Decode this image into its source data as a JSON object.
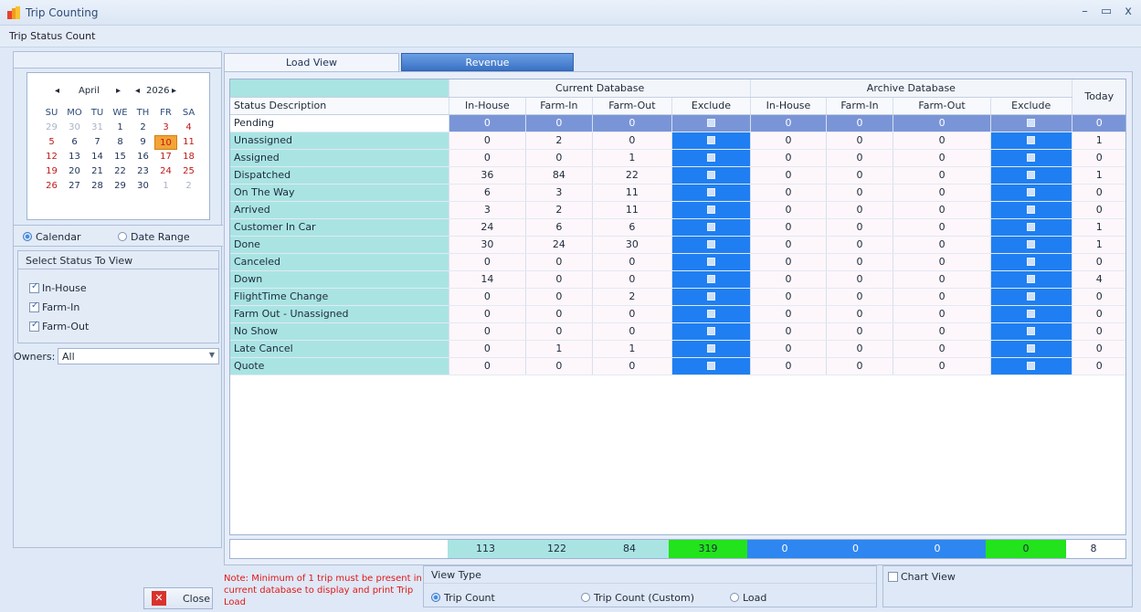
{
  "window": {
    "title": "Trip Counting",
    "controls": [
      "–",
      "▭",
      "x"
    ]
  },
  "subtitle": "Trip Status Count",
  "calendar": {
    "month": "April",
    "year": "2026",
    "prev": "◂",
    "next": "▸",
    "days_of_week": [
      "SU",
      "MO",
      "TU",
      "WE",
      "TH",
      "FR",
      "SA"
    ],
    "weeks": [
      [
        "29",
        "30",
        "31",
        "1",
        "2",
        "3",
        "4"
      ],
      [
        "5",
        "6",
        "7",
        "8",
        "9",
        "10",
        "11"
      ],
      [
        "12",
        "13",
        "14",
        "15",
        "16",
        "17",
        "18"
      ],
      [
        "19",
        "20",
        "21",
        "22",
        "23",
        "24",
        "25"
      ],
      [
        "26",
        "27",
        "28",
        "29",
        "30",
        "1",
        "2"
      ]
    ],
    "selected_day": "10"
  },
  "mode": {
    "calendar": "Calendar",
    "date_range": "Date Range",
    "selected": "calendar"
  },
  "status_filter": {
    "title": "Select Status To View",
    "items": [
      "In-House",
      "Farm-In",
      "Farm-Out"
    ]
  },
  "owners": {
    "label": "Owners:",
    "value": "All"
  },
  "close_label": "Close",
  "tabs": {
    "load_view": "Load View",
    "revenue": "Revenue"
  },
  "grid": {
    "groups": {
      "current": "Current Database",
      "archive": "Archive Database",
      "today": "Today"
    },
    "columns": [
      "Status Description",
      "In-House",
      "Farm-In",
      "Farm-Out",
      "Exclude",
      "In-House",
      "Farm-In",
      "Farm-Out",
      "Exclude"
    ],
    "rows": [
      {
        "desc": "Pending",
        "c": [
          "0",
          "0",
          "0"
        ],
        "a": [
          "0",
          "0",
          "0"
        ],
        "today": "0"
      },
      {
        "desc": "Unassigned",
        "c": [
          "0",
          "2",
          "0"
        ],
        "a": [
          "0",
          "0",
          "0"
        ],
        "today": "1"
      },
      {
        "desc": "Assigned",
        "c": [
          "0",
          "0",
          "1"
        ],
        "a": [
          "0",
          "0",
          "0"
        ],
        "today": "0"
      },
      {
        "desc": "Dispatched",
        "c": [
          "36",
          "84",
          "22"
        ],
        "a": [
          "0",
          "0",
          "0"
        ],
        "today": "1"
      },
      {
        "desc": "On The Way",
        "c": [
          "6",
          "3",
          "11"
        ],
        "a": [
          "0",
          "0",
          "0"
        ],
        "today": "0"
      },
      {
        "desc": "Arrived",
        "c": [
          "3",
          "2",
          "11"
        ],
        "a": [
          "0",
          "0",
          "0"
        ],
        "today": "0"
      },
      {
        "desc": "Customer In Car",
        "c": [
          "24",
          "6",
          "6"
        ],
        "a": [
          "0",
          "0",
          "0"
        ],
        "today": "1"
      },
      {
        "desc": "Done",
        "c": [
          "30",
          "24",
          "30"
        ],
        "a": [
          "0",
          "0",
          "0"
        ],
        "today": "1"
      },
      {
        "desc": "Canceled",
        "c": [
          "0",
          "0",
          "0"
        ],
        "a": [
          "0",
          "0",
          "0"
        ],
        "today": "0"
      },
      {
        "desc": "Down",
        "c": [
          "14",
          "0",
          "0"
        ],
        "a": [
          "0",
          "0",
          "0"
        ],
        "today": "4"
      },
      {
        "desc": "FlightTime Change",
        "c": [
          "0",
          "0",
          "2"
        ],
        "a": [
          "0",
          "0",
          "0"
        ],
        "today": "0"
      },
      {
        "desc": "Farm Out - Unassigned",
        "c": [
          "0",
          "0",
          "0"
        ],
        "a": [
          "0",
          "0",
          "0"
        ],
        "today": "0"
      },
      {
        "desc": "No Show",
        "c": [
          "0",
          "0",
          "0"
        ],
        "a": [
          "0",
          "0",
          "0"
        ],
        "today": "0"
      },
      {
        "desc": "Late Cancel",
        "c": [
          "0",
          "1",
          "1"
        ],
        "a": [
          "0",
          "0",
          "0"
        ],
        "today": "0"
      },
      {
        "desc": "Quote",
        "c": [
          "0",
          "0",
          "0"
        ],
        "a": [
          "0",
          "0",
          "0"
        ],
        "today": "0"
      }
    ],
    "totals": [
      "113",
      "122",
      "84",
      "319",
      "0",
      "0",
      "0",
      "0",
      "8"
    ]
  },
  "note": "Note: Minimum of 1 trip must be present in current database to display and print Trip Load",
  "view_type": {
    "title": "View Type",
    "options": [
      "Trip Count",
      "Trip Count (Custom)",
      "Load"
    ],
    "selected": "Trip Count"
  },
  "chart_view": "Chart View",
  "colors": {
    "teal": "#a9e4e3",
    "exclude_blue": "#1f7ff2",
    "green": "#22e31c",
    "selected_row": "#7a95d7",
    "note_red": "#e01818"
  }
}
